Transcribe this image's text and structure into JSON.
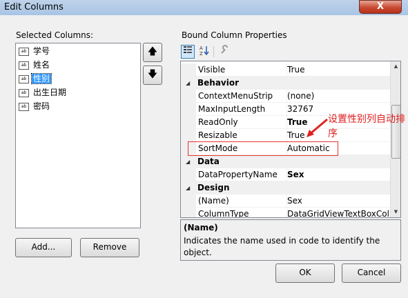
{
  "window": {
    "title": "Edit Columns",
    "close_label": "X"
  },
  "left": {
    "label": "Selected Columns:",
    "items": [
      {
        "label": "学号",
        "selected": false
      },
      {
        "label": "姓名",
        "selected": false
      },
      {
        "label": "性别",
        "selected": true
      },
      {
        "label": "出生日期",
        "selected": false
      },
      {
        "label": "密码",
        "selected": false
      }
    ],
    "item_icon": "ab",
    "up_label": "🡅",
    "down_label": "🡇",
    "add_label": "Add...",
    "remove_label": "Remove"
  },
  "right": {
    "label": "Bound Column Properties",
    "toolbar": {
      "categorized_icon": "categorized-icon",
      "alphabetical_icon": "alphabetical-icon",
      "wrench_icon": "wrench-icon"
    },
    "rows": [
      {
        "type": "prop",
        "name": "Visible",
        "value": "True",
        "bold": false
      },
      {
        "type": "cat",
        "name": "Behavior"
      },
      {
        "type": "prop",
        "name": "ContextMenuStrip",
        "value": "(none)",
        "bold": false
      },
      {
        "type": "prop",
        "name": "MaxInputLength",
        "value": "32767",
        "bold": false
      },
      {
        "type": "prop",
        "name": "ReadOnly",
        "value": "True",
        "bold": true
      },
      {
        "type": "prop",
        "name": "Resizable",
        "value": "True",
        "bold": false
      },
      {
        "type": "prop",
        "name": "SortMode",
        "value": "Automatic",
        "bold": false
      },
      {
        "type": "cat",
        "name": "Data"
      },
      {
        "type": "prop",
        "name": "DataPropertyName",
        "value": "Sex",
        "bold": true
      },
      {
        "type": "cat",
        "name": "Design"
      },
      {
        "type": "prop",
        "name": "(Name)",
        "value": "Sex",
        "bold": false
      },
      {
        "type": "prop",
        "name": "ColumnType",
        "value": "DataGridViewTextBoxColu",
        "bold": false
      }
    ],
    "description": {
      "title": "(Name)",
      "text": "Indicates the name used in code to identify the object."
    }
  },
  "buttons": {
    "ok_label": "OK",
    "cancel_label": "Cancel"
  },
  "annotation": {
    "text": "设置性别列自动排序",
    "color": "#e02020"
  }
}
